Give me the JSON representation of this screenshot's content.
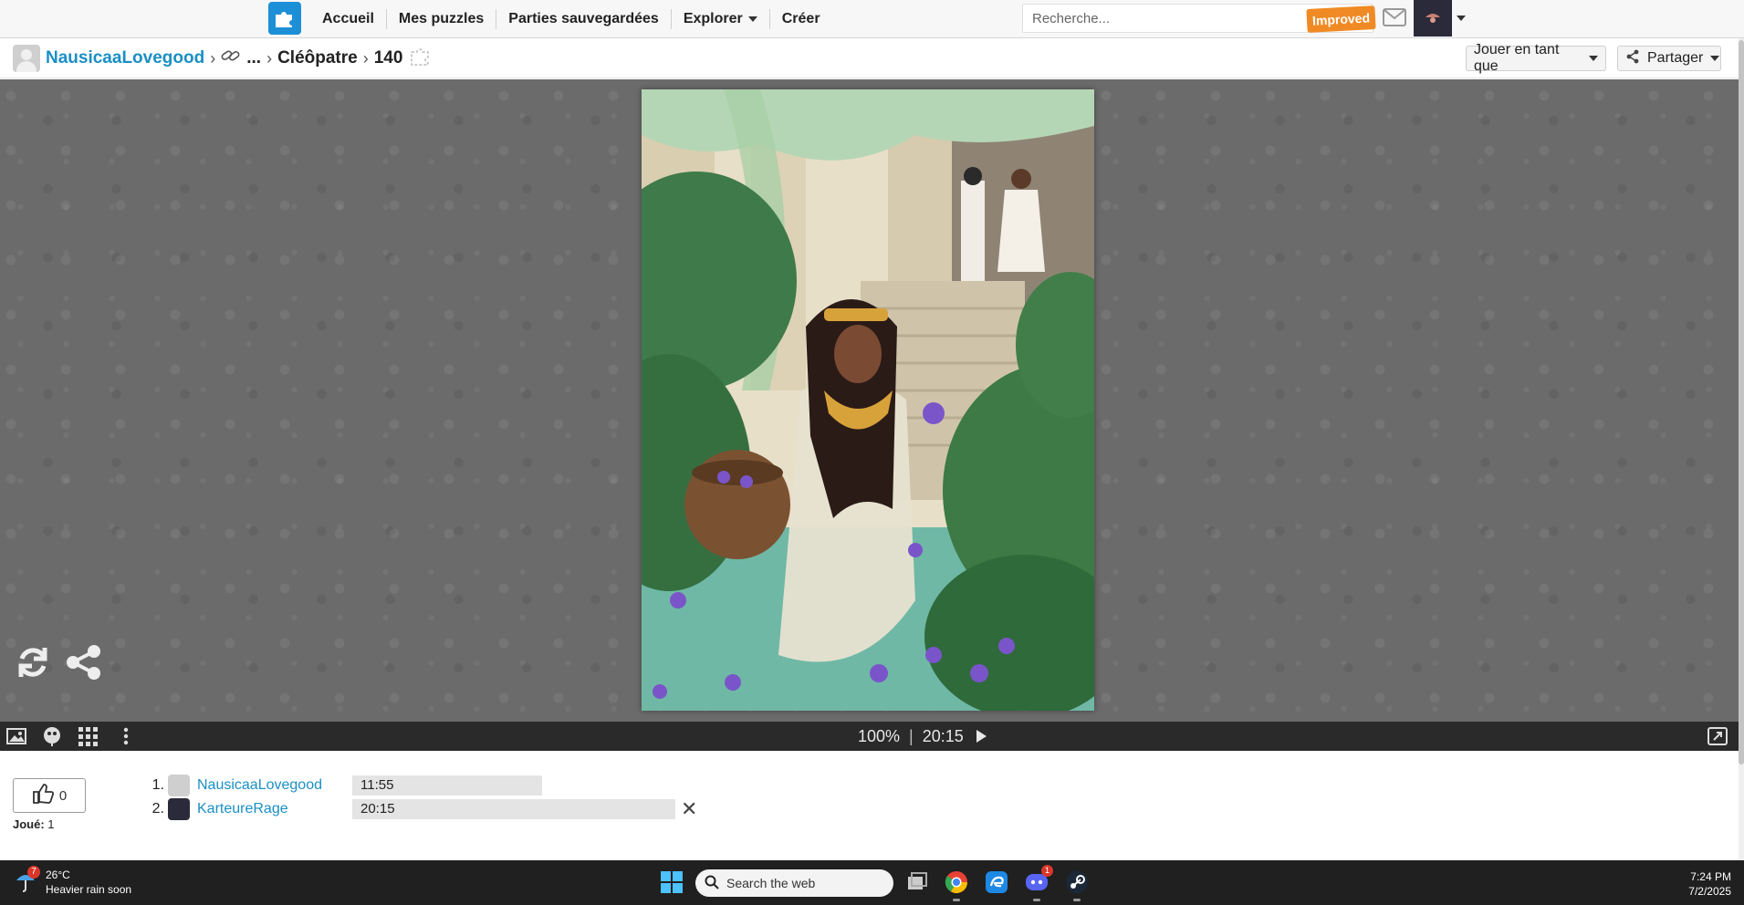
{
  "nav": {
    "items": [
      {
        "label": "Accueil"
      },
      {
        "label": "Mes puzzles"
      },
      {
        "label": "Parties sauvegardées"
      },
      {
        "label": "Explorer"
      },
      {
        "label": "Créer"
      }
    ],
    "search_placeholder": "Recherche...",
    "improved_badge": "Improved"
  },
  "breadcrumb": {
    "user": "NausicaaLovegood",
    "ellipsis": "...",
    "title": "Cléôpatre",
    "pieces": "140"
  },
  "actions": {
    "play_as": "Jouer en tant que",
    "share": "Partager"
  },
  "toolbar": {
    "zoom": "100%",
    "separator": "|",
    "timer": "20:15"
  },
  "stats": {
    "likes": "0",
    "played_label": "Joué:",
    "played_value": "1"
  },
  "scores": [
    {
      "rank": "1.",
      "name": "NausicaaLovegood",
      "time": "11:55"
    },
    {
      "rank": "2.",
      "name": "KarteureRage",
      "time": "20:15"
    }
  ],
  "taskbar": {
    "weather_badge": "7",
    "temperature": "26°C",
    "forecast": "Heavier rain soon",
    "search_placeholder": "Search the web",
    "discord_badge": "1",
    "time": "7:24 PM",
    "date": "7/2/2025"
  },
  "colors": {
    "link": "#1a8fc4",
    "brand": "#1d8fd6",
    "badge_orange": "#f08a24",
    "play_bg": "#6b6b6b",
    "toolbar_bg": "#2a2a2a"
  }
}
